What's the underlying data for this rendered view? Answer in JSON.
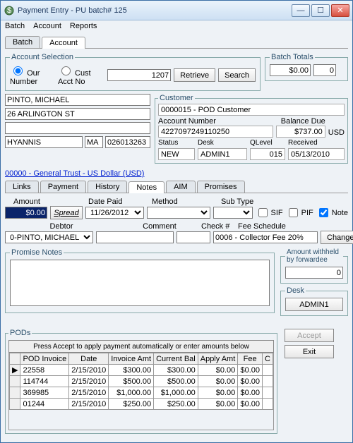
{
  "window": {
    "title": "Payment Entry - PU batch# 125"
  },
  "menubar": {
    "batch": "Batch",
    "account": "Account",
    "reports": "Reports"
  },
  "topTabs": {
    "batch": "Batch",
    "account": "Account"
  },
  "acctSel": {
    "legend": "Account Selection",
    "ourNumberLabel": "Our Number",
    "custAcctNoLabel": "Cust Acct No",
    "value": "1207",
    "retrieve": "Retrieve",
    "search": "Search"
  },
  "batchTotals": {
    "legend": "Batch Totals",
    "amt": "$0.00",
    "count": "0"
  },
  "address": {
    "name": "PINTO, MICHAEL",
    "street": "26 ARLINGTON ST",
    "line3": "",
    "city": "HYANNIS",
    "state": "MA",
    "zip": "026013263"
  },
  "customer": {
    "legend_cust": "Customer",
    "cust": "0000015 - POD Customer",
    "legend_acct": "Account Number",
    "legend_bal": "Balance Due",
    "acct": "4227097249110250",
    "bal": "$737.00",
    "usd": "USD",
    "hd_status": "Status",
    "hd_desk": "Desk",
    "hd_qlevel": "QLevel",
    "hd_received": "Received",
    "status": "NEW",
    "desk": "ADMIN1",
    "qlevel": "015",
    "received": "05/13/2010"
  },
  "schemeLink": "00000 - General Trust - US Dollar (USD)",
  "payTabs": {
    "links": "Links",
    "payment": "Payment",
    "history": "History",
    "notes": "Notes",
    "aim": "AIM",
    "promises": "Promises"
  },
  "paymentFields": {
    "amountLbl": "Amount",
    "datePaidLbl": "Date Paid",
    "methodLbl": "Method",
    "subTypeLbl": "Sub Type",
    "spreadBtn": "Spread",
    "datePaid": "11/26/2012",
    "amount": "$0.00",
    "sifLbl": "SIF",
    "pifLbl": "PIF",
    "noteLbl": "Note",
    "debtorLbl": "Debtor",
    "commentLbl": "Comment",
    "checkLbl": "Check #",
    "feeSchedLbl": "Fee Schedule",
    "debtor": "0-PINTO, MICHAEL",
    "feeSched": "0006 - Collector Fee 20%",
    "changeBtn": "Change"
  },
  "promiseNotes": {
    "legend": "Promise Notes"
  },
  "amtWithheld": {
    "legend": "Amount withheld by forwardee",
    "val": "0"
  },
  "deskBox": {
    "legend": "Desk",
    "val": "ADMIN1"
  },
  "pods": {
    "legend": "PODs",
    "instruction": "Press Accept to apply payment automatically or enter amounts below",
    "cols": {
      "inv": "POD Invoice",
      "date": "Date",
      "invAmt": "Invoice Amt",
      "curBal": "Current Bal",
      "applyAmt": "Apply Amt",
      "fee": "Fee",
      "c": "C"
    },
    "rows": [
      {
        "inv": "22558",
        "date": "2/15/2010",
        "invAmt": "$300.00",
        "curBal": "$300.00",
        "applyAmt": "$0.00",
        "fee": "$0.00"
      },
      {
        "inv": "114744",
        "date": "2/15/2010",
        "invAmt": "$500.00",
        "curBal": "$500.00",
        "applyAmt": "$0.00",
        "fee": "$0.00"
      },
      {
        "inv": "369985",
        "date": "2/15/2010",
        "invAmt": "$1,000.00",
        "curBal": "$1,000.00",
        "applyAmt": "$0.00",
        "fee": "$0.00"
      },
      {
        "inv": "01244",
        "date": "2/15/2010",
        "invAmt": "$250.00",
        "curBal": "$250.00",
        "applyAmt": "$0.00",
        "fee": "$0.00"
      }
    ]
  },
  "sideButtons": {
    "accept": "Accept",
    "exit": "Exit"
  }
}
